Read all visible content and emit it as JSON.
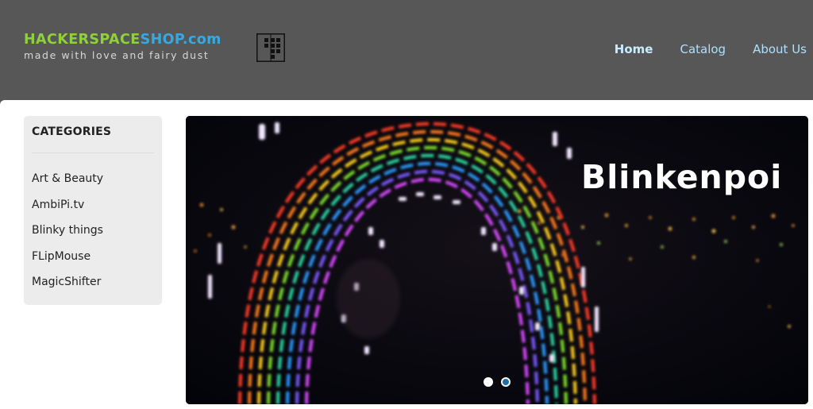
{
  "header": {
    "logo": {
      "part1": "HACKERSPACE",
      "part2": "SHOP.com",
      "tagline": "made with love and fairy dust",
      "part1_color": "#8fd13b",
      "part2_color": "#3aa8e0",
      "mark_icon": "pixel-block-logo-icon"
    },
    "nav": [
      {
        "label": "Home",
        "active": true
      },
      {
        "label": "Catalog",
        "active": false
      },
      {
        "label": "About Us",
        "active": false
      }
    ]
  },
  "sidebar": {
    "title": "CATEGORIES",
    "items": [
      {
        "label": "Art & Beauty"
      },
      {
        "label": "AmbiPi.tv"
      },
      {
        "label": "Blinky things"
      },
      {
        "label": "FLipMouse"
      },
      {
        "label": "MagicShifter"
      }
    ]
  },
  "slider": {
    "caption": "Blinkenpoi",
    "current_slide": 2,
    "slide_count": 2,
    "image_description_icon": "rainbow-led-light-painting-image"
  },
  "colors": {
    "header_bg": "#575757",
    "nav_link": "#aee0fb",
    "sidebar_bg": "#ececec",
    "slider_bg": "#05060a",
    "active_dot": "#1e6fa8"
  }
}
